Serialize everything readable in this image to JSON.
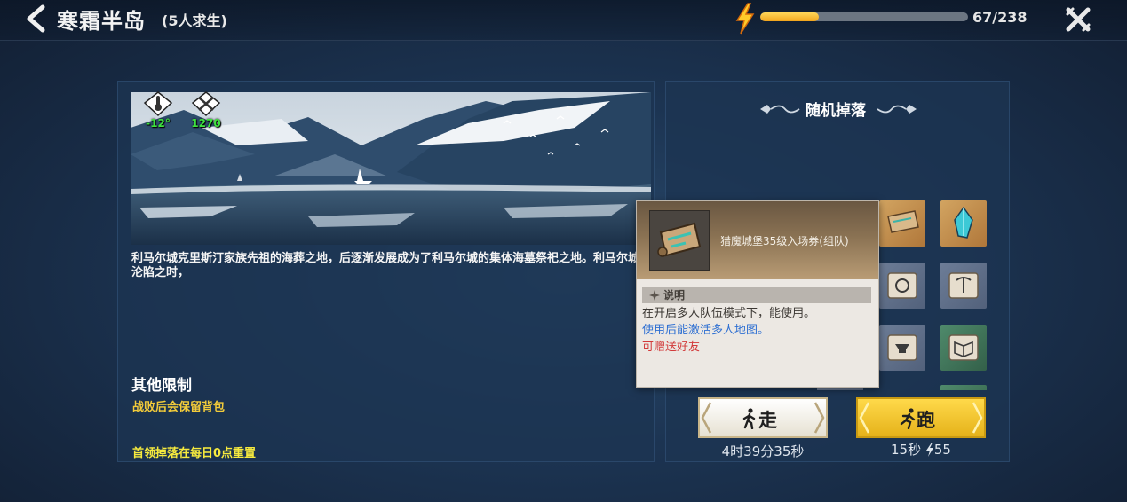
{
  "header": {
    "title": "寒霜半岛",
    "subtitle": "(5人求生)",
    "energy": {
      "current": 67,
      "max": 238,
      "text": "67/238"
    }
  },
  "scene": {
    "temperature": "-12°",
    "stat_value": "1270"
  },
  "description": "利马尔城克里斯汀家族先祖的海葬之地，后逐渐发展成为了利马尔城的集体海墓祭祀之地。利马尔城沦陷之时，",
  "limits": {
    "title": "其他限制",
    "item": "战败后会保留背包",
    "reset_note": "首领掉落在每日0点重置"
  },
  "drops": {
    "title": "随机掉落",
    "items": [
      {
        "icon": "map-scroll-icon",
        "color": "gold"
      },
      {
        "icon": "teal-crystal-icon",
        "color": "gold"
      },
      {
        "icon": "fist-scroll-icon",
        "color": "blue"
      },
      {
        "icon": "pickaxe-scroll-icon",
        "color": "blue"
      },
      {
        "icon": "anvil-scroll-icon",
        "color": "blue"
      },
      {
        "icon": "book-scroll-icon",
        "color": "green"
      }
    ]
  },
  "walk": {
    "label": "走",
    "time": "4时39分35秒"
  },
  "run": {
    "label": "跑",
    "time": "15秒",
    "cost": "55"
  },
  "tooltip": {
    "name": "猎魔城堡35级入场券(组队)",
    "section": "说明",
    "line1": "在开启多人队伍模式下，能使用。",
    "line2": "使用后能激活多人地图。",
    "line3": "可赠送好友"
  },
  "colors": {
    "energy_fill": "#f2a51c",
    "stat_green": "#3ee23e",
    "limit_gold": "#f2cb3a",
    "reset_yellow": "#f6ea3e",
    "tip_blue": "#2e6fd2",
    "tip_red": "#d23a3a"
  }
}
